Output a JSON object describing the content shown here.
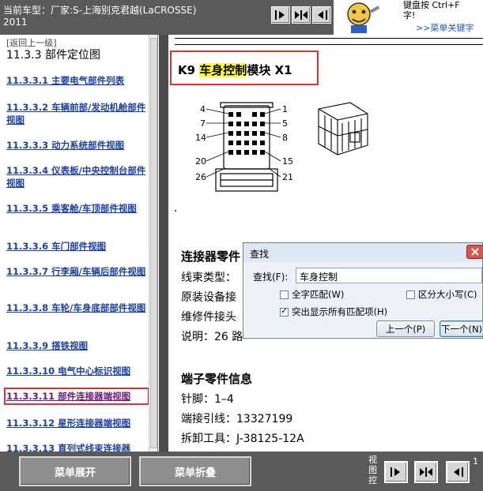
{
  "header": {
    "car_line1": "当前车型：厂家:S-上海别克君越(LaCROSSE)",
    "car_line2": "2011",
    "view_buttons": [
      "expand-left-icon",
      "expand-both-icon",
      "collapse-left-icon"
    ],
    "hint_line1": "键盘按  Ctrl+F",
    "hint_line2": "字!",
    "hint_link": ">>菜单关键字"
  },
  "nav": {
    "back_label": "[返回上一级]",
    "heading": "11.3.3 部件定位图",
    "items": [
      {
        "label": "11.3.3.1 主要电气部件列表"
      },
      {
        "label": "11.3.3.2 车辆前部/发动机舱部件视图"
      },
      {
        "label": "11.3.3.3 动力系统部件视图"
      },
      {
        "label": "11.3.3.4 仪表板/中央控制台部件视图"
      },
      {
        "label": "11.3.3.5 乘客舱/车顶部件视图"
      },
      {
        "label": "11.3.3.6 车门部件视图"
      },
      {
        "label": "11.3.3.7 行李厢/车辆后部件视图"
      },
      {
        "label": "11.3.3.8 车轮/车身底部部件视图"
      },
      {
        "label": "11.3.3.9 搭铁视图"
      },
      {
        "label": "11.3.3.10 电气中心标识视图"
      },
      {
        "label": "11.3.3.11 部件连接器端视图"
      },
      {
        "label": "11.3.3.12 星形连接器端视图"
      },
      {
        "label": "11.3.3.13 直列式线束连接器"
      }
    ]
  },
  "content": {
    "title_prefix": "K9 ",
    "title_highlight": "车身控制",
    "title_suffix": "模块  X1",
    "pin_labels": [
      "4",
      "1",
      "7",
      "5",
      "14",
      "8",
      "20",
      "15",
      "26",
      "21"
    ],
    "connector_info_heading": "连接器零件",
    "connector_info_lines": [
      "线束类型：",
      "原装设备接",
      "维修件接头",
      "说明：26 路"
    ],
    "terminal_heading": "端子零件信息",
    "terminal_lines": [
      "针脚：1–4",
      "端接引线：13327199",
      "拆卸工具：J-38125-12A"
    ]
  },
  "find_dialog": {
    "title": "查找",
    "find_label": "查找(F):",
    "find_value": "车身控制",
    "opt_whole_word": "全字匹配(W)",
    "opt_match_case": "区分大小写(C)",
    "opt_highlight_all": "突出显示所有匹配项(H)",
    "btn_prev": "上一个(P)",
    "btn_next": "下一个(N)"
  },
  "footer": {
    "expand_menu": "菜单展开",
    "collapse_menu": "菜单折叠",
    "view_control": "视图控",
    "page_digit": "1"
  },
  "colors": {
    "bar_bg": "#5a5a5a",
    "highlight": "#ffff33",
    "red_outline": "#e03030",
    "link": "#1a3fa8"
  }
}
